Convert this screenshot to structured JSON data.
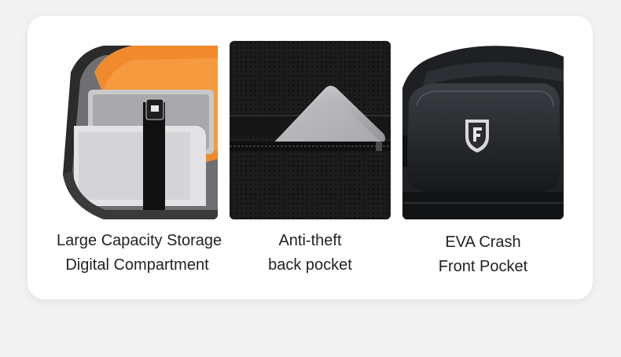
{
  "features": [
    {
      "icon": "laptop-compartment-photo",
      "caption_line1": "Large Capacity Storage",
      "caption_line2": "Digital Compartment"
    },
    {
      "icon": "back-pocket-tablet-photo",
      "caption_line1": "Anti-theft",
      "caption_line2": "back pocket"
    },
    {
      "icon": "front-pocket-shield-photo",
      "caption_line1": "EVA Crash",
      "caption_line2": "Front Pocket"
    }
  ],
  "colors": {
    "background": "#f2f2f2",
    "card": "#ffffff",
    "lining_orange": "#f08a2c",
    "bag_black": "#1a1a1a"
  }
}
